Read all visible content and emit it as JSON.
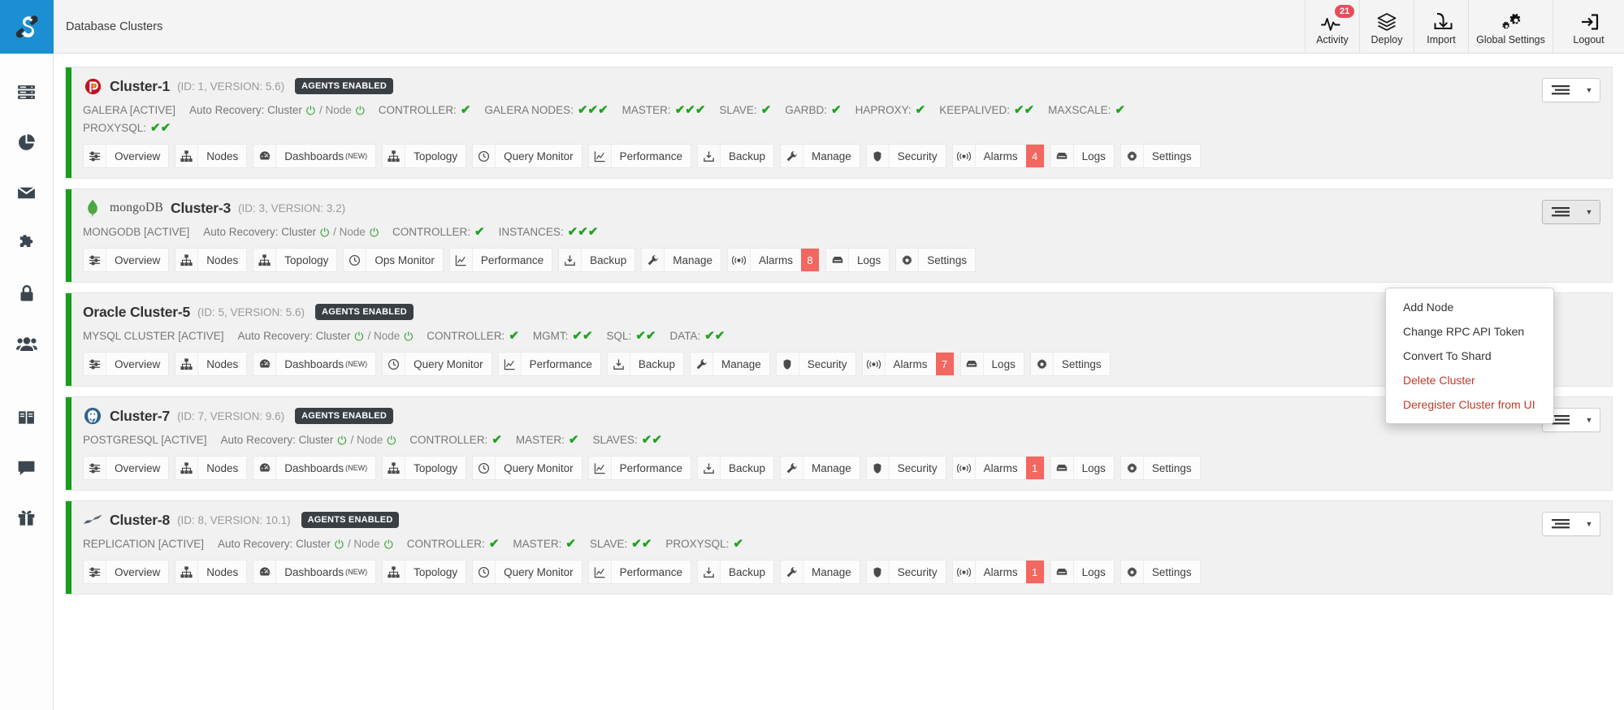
{
  "app": {
    "logo": "severalnines-logo",
    "page_title": "Database Clusters"
  },
  "sidebar": {
    "items": [
      {
        "icon": "servers-icon",
        "name": "sidebar-item-clusters"
      },
      {
        "icon": "pie-chart-icon",
        "name": "sidebar-item-reports"
      },
      {
        "icon": "mail-icon",
        "name": "sidebar-item-email-notifications"
      },
      {
        "icon": "puzzle-icon",
        "name": "sidebar-item-integrations"
      },
      {
        "icon": "lock-icon",
        "name": "sidebar-item-key-management"
      },
      {
        "icon": "users-icon",
        "name": "sidebar-item-user-management"
      },
      {
        "icon": "book-icon",
        "name": "sidebar-item-documentation"
      },
      {
        "icon": "chat-icon",
        "name": "sidebar-item-support"
      },
      {
        "icon": "gift-icon",
        "name": "sidebar-item-whats-new"
      }
    ]
  },
  "topnav": {
    "items": [
      {
        "label": "Activity",
        "icon": "activity-pulse-icon",
        "badge": "21"
      },
      {
        "label": "Deploy",
        "icon": "stack-layers-icon",
        "badge": ""
      },
      {
        "label": "Import",
        "icon": "import-download-icon",
        "badge": ""
      },
      {
        "label": "Global Settings",
        "icon": "gears-icon",
        "badge": ""
      },
      {
        "label": "Logout",
        "icon": "logout-arrow-icon",
        "badge": ""
      }
    ]
  },
  "colors": {
    "accent_green": "#15a01b",
    "brand_blue": "#1b8fd1",
    "alarm_red": "#f2675f",
    "badge_red": "#ea4c5a",
    "danger_text": "#c0392b",
    "pill_dark": "#3a3f44"
  },
  "dropdown": {
    "open_for_cluster": "Cluster-3",
    "items": [
      {
        "label": "Add Node",
        "danger": false
      },
      {
        "label": "Change RPC API Token",
        "danger": false
      },
      {
        "label": "Convert To Shard",
        "danger": false
      },
      {
        "label": "Delete Cluster",
        "danger": true
      },
      {
        "label": "Deregister Cluster from UI",
        "danger": true
      }
    ]
  },
  "menu_button": {
    "icon": "list-menu-icon",
    "caret": "▼"
  },
  "clusters": [
    {
      "name": "Cluster-1",
      "meta": "(ID: 1, VERSION: 5.6)",
      "logo": "percona-icon",
      "agents_badge": "AGENTS ENABLED",
      "status_prefix": "GALERA [ACTIVE]",
      "auto_recovery_label": "Auto Recovery: Cluster",
      "auto_recovery_node_label": "/ Node",
      "statuses": [
        {
          "label": "CONTROLLER:",
          "ticks": 1
        },
        {
          "label": "GALERA NODES:",
          "ticks": 3
        },
        {
          "label": "MASTER:",
          "ticks": 3
        },
        {
          "label": "SLAVE:",
          "ticks": 1
        },
        {
          "label": "GARBD:",
          "ticks": 1
        },
        {
          "label": "HAPROXY:",
          "ticks": 1
        },
        {
          "label": "KEEPALIVED:",
          "ticks": 2
        },
        {
          "label": "MAXSCALE:",
          "ticks": 1
        },
        {
          "label": "PROXYSQL:",
          "ticks": 2
        }
      ],
      "tabs": [
        {
          "label": "Overview",
          "icon": "sliders-icon",
          "new": false,
          "count": ""
        },
        {
          "label": "Nodes",
          "icon": "hierarchy-icon",
          "new": false,
          "count": ""
        },
        {
          "label": "Dashboards",
          "icon": "gauge-icon",
          "new": true,
          "count": ""
        },
        {
          "label": "Topology",
          "icon": "hierarchy-icon",
          "new": false,
          "count": ""
        },
        {
          "label": "Query Monitor",
          "icon": "clock-icon",
          "new": false,
          "count": ""
        },
        {
          "label": "Performance",
          "icon": "chart-line-icon",
          "new": false,
          "count": ""
        },
        {
          "label": "Backup",
          "icon": "backup-icon",
          "new": false,
          "count": ""
        },
        {
          "label": "Manage",
          "icon": "wrench-icon",
          "new": false,
          "count": ""
        },
        {
          "label": "Security",
          "icon": "shield-icon",
          "new": false,
          "count": ""
        },
        {
          "label": "Alarms",
          "icon": "signal-icon",
          "new": false,
          "count": "4"
        },
        {
          "label": "Logs",
          "icon": "logs-icon",
          "new": false,
          "count": ""
        },
        {
          "label": "Settings",
          "icon": "gear-icon",
          "new": false,
          "count": ""
        }
      ]
    },
    {
      "name": "Cluster-3",
      "meta": "(ID: 3, VERSION: 3.2)",
      "logo": "mongodb-icon",
      "logo_word": "mongoDB",
      "agents_badge": "",
      "status_prefix": "MONGODB [ACTIVE]",
      "auto_recovery_label": "Auto Recovery: Cluster",
      "auto_recovery_node_label": "/ Node",
      "statuses": [
        {
          "label": "CONTROLLER:",
          "ticks": 1
        },
        {
          "label": "INSTANCES:",
          "ticks": 3
        }
      ],
      "tabs": [
        {
          "label": "Overview",
          "icon": "sliders-icon",
          "new": false,
          "count": ""
        },
        {
          "label": "Nodes",
          "icon": "hierarchy-icon",
          "new": false,
          "count": ""
        },
        {
          "label": "Topology",
          "icon": "hierarchy-icon",
          "new": false,
          "count": ""
        },
        {
          "label": "Ops Monitor",
          "icon": "clock-icon",
          "new": false,
          "count": ""
        },
        {
          "label": "Performance",
          "icon": "chart-line-icon",
          "new": false,
          "count": ""
        },
        {
          "label": "Backup",
          "icon": "backup-icon",
          "new": false,
          "count": ""
        },
        {
          "label": "Manage",
          "icon": "wrench-icon",
          "new": false,
          "count": ""
        },
        {
          "label": "Alarms",
          "icon": "signal-icon",
          "new": false,
          "count": "8"
        },
        {
          "label": "Logs",
          "icon": "logs-icon",
          "new": false,
          "count": ""
        },
        {
          "label": "Settings",
          "icon": "gear-icon",
          "new": false,
          "count": ""
        }
      ]
    },
    {
      "name": "Oracle Cluster-5",
      "meta": "(ID: 5, VERSION: 5.6)",
      "logo": "",
      "agents_badge": "AGENTS ENABLED",
      "status_prefix": "MYSQL CLUSTER [ACTIVE]",
      "auto_recovery_label": "Auto Recovery: Cluster",
      "auto_recovery_node_label": "/ Node",
      "statuses": [
        {
          "label": "CONTROLLER:",
          "ticks": 1
        },
        {
          "label": "MGMT:",
          "ticks": 2
        },
        {
          "label": "SQL:",
          "ticks": 2
        },
        {
          "label": "DATA:",
          "ticks": 2
        }
      ],
      "tabs": [
        {
          "label": "Overview",
          "icon": "sliders-icon",
          "new": false,
          "count": ""
        },
        {
          "label": "Nodes",
          "icon": "hierarchy-icon",
          "new": false,
          "count": ""
        },
        {
          "label": "Dashboards",
          "icon": "gauge-icon",
          "new": true,
          "count": ""
        },
        {
          "label": "Query Monitor",
          "icon": "clock-icon",
          "new": false,
          "count": ""
        },
        {
          "label": "Performance",
          "icon": "chart-line-icon",
          "new": false,
          "count": ""
        },
        {
          "label": "Backup",
          "icon": "backup-icon",
          "new": false,
          "count": ""
        },
        {
          "label": "Manage",
          "icon": "wrench-icon",
          "new": false,
          "count": ""
        },
        {
          "label": "Security",
          "icon": "shield-icon",
          "new": false,
          "count": ""
        },
        {
          "label": "Alarms",
          "icon": "signal-icon",
          "new": false,
          "count": "7"
        },
        {
          "label": "Logs",
          "icon": "logs-icon",
          "new": false,
          "count": ""
        },
        {
          "label": "Settings",
          "icon": "gear-icon",
          "new": false,
          "count": ""
        }
      ]
    },
    {
      "name": "Cluster-7",
      "meta": "(ID: 7, VERSION: 9.6)",
      "logo": "postgresql-icon",
      "agents_badge": "AGENTS ENABLED",
      "status_prefix": "POSTGRESQL [ACTIVE]",
      "auto_recovery_label": "Auto Recovery: Cluster",
      "auto_recovery_node_label": "/ Node",
      "statuses": [
        {
          "label": "CONTROLLER:",
          "ticks": 1
        },
        {
          "label": "MASTER:",
          "ticks": 1
        },
        {
          "label": "SLAVES:",
          "ticks": 2
        }
      ],
      "tabs": [
        {
          "label": "Overview",
          "icon": "sliders-icon",
          "new": false,
          "count": ""
        },
        {
          "label": "Nodes",
          "icon": "hierarchy-icon",
          "new": false,
          "count": ""
        },
        {
          "label": "Dashboards",
          "icon": "gauge-icon",
          "new": true,
          "count": ""
        },
        {
          "label": "Topology",
          "icon": "hierarchy-icon",
          "new": false,
          "count": ""
        },
        {
          "label": "Query Monitor",
          "icon": "clock-icon",
          "new": false,
          "count": ""
        },
        {
          "label": "Performance",
          "icon": "chart-line-icon",
          "new": false,
          "count": ""
        },
        {
          "label": "Backup",
          "icon": "backup-icon",
          "new": false,
          "count": ""
        },
        {
          "label": "Manage",
          "icon": "wrench-icon",
          "new": false,
          "count": ""
        },
        {
          "label": "Security",
          "icon": "shield-icon",
          "new": false,
          "count": ""
        },
        {
          "label": "Alarms",
          "icon": "signal-icon",
          "new": false,
          "count": "1"
        },
        {
          "label": "Logs",
          "icon": "logs-icon",
          "new": false,
          "count": ""
        },
        {
          "label": "Settings",
          "icon": "gear-icon",
          "new": false,
          "count": ""
        }
      ]
    },
    {
      "name": "Cluster-8",
      "meta": "(ID: 8, VERSION: 10.1)",
      "logo": "mariadb-icon",
      "agents_badge": "AGENTS ENABLED",
      "status_prefix": "REPLICATION [ACTIVE]",
      "auto_recovery_label": "Auto Recovery: Cluster",
      "auto_recovery_node_label": "/ Node",
      "statuses": [
        {
          "label": "CONTROLLER:",
          "ticks": 1
        },
        {
          "label": "MASTER:",
          "ticks": 1
        },
        {
          "label": "SLAVE:",
          "ticks": 2
        },
        {
          "label": "PROXYSQL:",
          "ticks": 1
        }
      ],
      "tabs": [
        {
          "label": "Overview",
          "icon": "sliders-icon",
          "new": false,
          "count": ""
        },
        {
          "label": "Nodes",
          "icon": "hierarchy-icon",
          "new": false,
          "count": ""
        },
        {
          "label": "Dashboards",
          "icon": "gauge-icon",
          "new": true,
          "count": ""
        },
        {
          "label": "Topology",
          "icon": "hierarchy-icon",
          "new": false,
          "count": ""
        },
        {
          "label": "Query Monitor",
          "icon": "clock-icon",
          "new": false,
          "count": ""
        },
        {
          "label": "Performance",
          "icon": "chart-line-icon",
          "new": false,
          "count": ""
        },
        {
          "label": "Backup",
          "icon": "backup-icon",
          "new": false,
          "count": ""
        },
        {
          "label": "Manage",
          "icon": "wrench-icon",
          "new": false,
          "count": ""
        },
        {
          "label": "Security",
          "icon": "shield-icon",
          "new": false,
          "count": ""
        },
        {
          "label": "Alarms",
          "icon": "signal-icon",
          "new": false,
          "count": "1"
        },
        {
          "label": "Logs",
          "icon": "logs-icon",
          "new": false,
          "count": ""
        },
        {
          "label": "Settings",
          "icon": "gear-icon",
          "new": false,
          "count": ""
        }
      ]
    }
  ]
}
